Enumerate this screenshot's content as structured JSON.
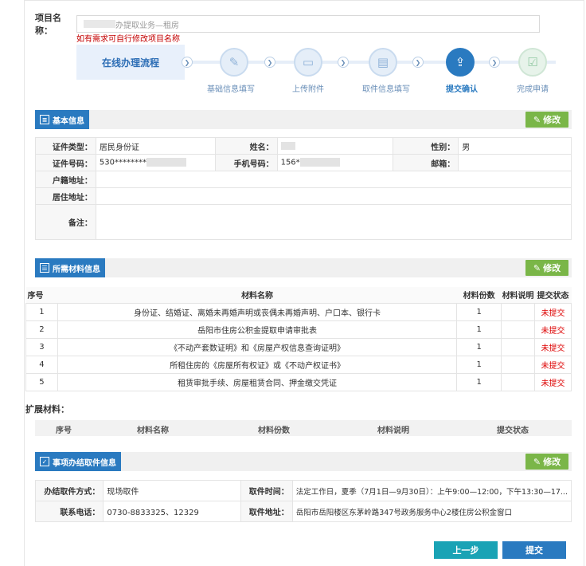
{
  "project": {
    "label": "项目名称：",
    "value": "办提取业务—租房",
    "hint": "如有需求可自行修改项目名称"
  },
  "flow": {
    "title": "在线办理流程",
    "steps": [
      {
        "label": "基础信息填写",
        "icon": "edit-doc-icon"
      },
      {
        "label": "上传附件",
        "icon": "folder-upload-icon"
      },
      {
        "label": "取件信息填写",
        "icon": "document-list-icon"
      },
      {
        "label": "提交确认",
        "icon": "upload-confirm-icon"
      },
      {
        "label": "完成申请",
        "icon": "check-box-icon"
      }
    ],
    "active_index": 3
  },
  "basic": {
    "title": "基本信息",
    "edit": "修改",
    "id_type_label": "证件类型：",
    "id_type": "居民身份证",
    "name_label": "姓名：",
    "name": "",
    "gender_label": "性别：",
    "gender": "男",
    "id_no_label": "证件号码：",
    "id_no": "530********",
    "phone_label": "手机号码：",
    "phone": "156*",
    "email_label": "邮箱：",
    "email": "",
    "hukou_label": "户籍地址：",
    "hukou": "",
    "residence_label": "居住地址：",
    "residence": "",
    "remark_label": "备注：",
    "remark": ""
  },
  "materials": {
    "title": "所需材料信息",
    "edit": "修改",
    "headers": [
      "序号",
      "材料名称",
      "材料份数",
      "材料说明",
      "提交状态"
    ],
    "rows": [
      {
        "no": "1",
        "name": "身份证、结婚证、离婚未再婚声明或丧偶未再婚声明、户口本、银行卡",
        "count": "1",
        "note": "",
        "status": "未提交"
      },
      {
        "no": "2",
        "name": "岳阳市住房公积金提取申请审批表",
        "count": "1",
        "note": "",
        "status": "未提交"
      },
      {
        "no": "3",
        "name": "《不动产套数证明》和《房屋产权信息查询证明》",
        "count": "1",
        "note": "",
        "status": "未提交"
      },
      {
        "no": "4",
        "name": "所租住房的《房屋所有权证》或《不动产权证书》",
        "count": "1",
        "note": "",
        "status": "未提交"
      },
      {
        "no": "5",
        "name": "租赁审批手续、房屋租赁合同、押金缴交凭证",
        "count": "1",
        "note": "",
        "status": "未提交"
      }
    ]
  },
  "extended": {
    "label": "扩展材料：",
    "headers": [
      "序号",
      "材料名称",
      "材料份数",
      "材料说明",
      "提交状态"
    ]
  },
  "pickup": {
    "title": "事项办结取件信息",
    "edit": "修改",
    "method_label": "办结取件方式：",
    "method": "现场取件",
    "time_label": "取件时间：",
    "time": "法定工作日，夏季（7月1日—9月30日）：上午9:00—12:00，下午13:30—17...",
    "phone_label": "联系电话：",
    "phone": "0730-8833325、12329",
    "address_label": "取件地址：",
    "address": "岳阳市岳阳楼区东茅岭路347号政务服务中心2楼住房公积金窗口"
  },
  "buttons": {
    "prev": "上一步",
    "submit": "提交"
  },
  "colors": {
    "primary": "#2a7ac0",
    "edit_green": "#7ab648",
    "status_red": "#dd0000",
    "prev_teal": "#1aa3b5"
  }
}
